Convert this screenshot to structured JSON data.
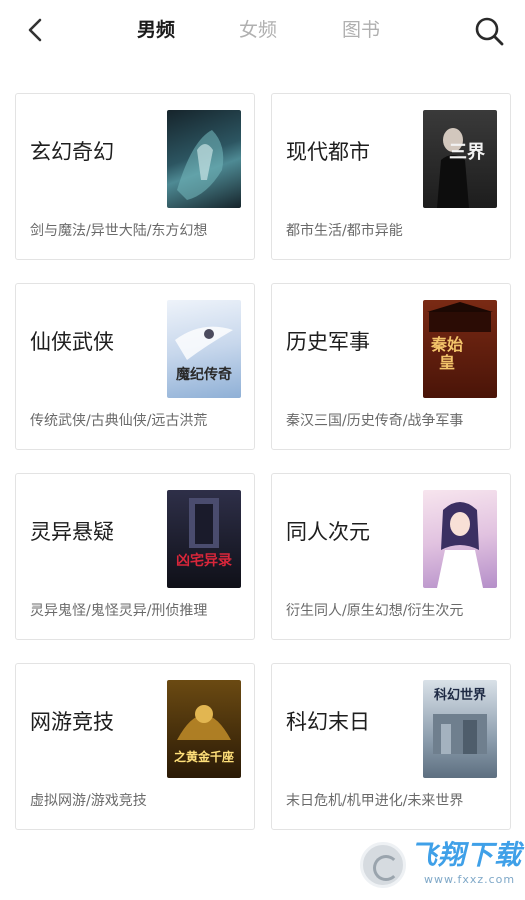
{
  "header": {
    "tabs": [
      {
        "label": "男频",
        "active": true
      },
      {
        "label": "女频",
        "active": false
      },
      {
        "label": "图书",
        "active": false
      }
    ]
  },
  "categories": [
    {
      "title": "玄幻奇幻",
      "subtitle": "剑与魔法/异世大陆/东方幻想",
      "cover_colors": [
        "#16242b",
        "#3f6f7a"
      ],
      "cover_text": ""
    },
    {
      "title": "现代都市",
      "subtitle": "都市生活/都市异能",
      "cover_colors": [
        "#2b2b2b",
        "#6d6d6d"
      ],
      "cover_text": "三界"
    },
    {
      "title": "仙侠武侠",
      "subtitle": "传统武侠/古典仙侠/远古洪荒",
      "cover_colors": [
        "#dfe8f4",
        "#9eb7d6"
      ],
      "cover_text": "魔纪传奇"
    },
    {
      "title": "历史军事",
      "subtitle": "秦汉三国/历史传奇/战争军事",
      "cover_colors": [
        "#5a1c10",
        "#b5482a"
      ],
      "cover_text": "秦始皇"
    },
    {
      "title": "灵异悬疑",
      "subtitle": "灵异鬼怪/鬼怪灵异/刑侦推理",
      "cover_colors": [
        "#141521",
        "#3a3b55"
      ],
      "cover_text": "凶宅异录"
    },
    {
      "title": "同人次元",
      "subtitle": "衍生同人/原生幻想/衍生次元",
      "cover_colors": [
        "#f3dbe8",
        "#c9a1d2"
      ],
      "cover_text": ""
    },
    {
      "title": "网游竞技",
      "subtitle": "虚拟网游/游戏竞技",
      "cover_colors": [
        "#2a1a06",
        "#a06d17"
      ],
      "cover_text": "之黄金千座"
    },
    {
      "title": "科幻末日",
      "subtitle": "末日危机/机甲进化/未来世界",
      "cover_colors": [
        "#9fb0bf",
        "#5d6f80"
      ],
      "cover_text": "科幻世界"
    }
  ],
  "watermark": {
    "title": "飞翔下载",
    "url": "www.fxxz.com"
  },
  "icons": {
    "back": "back-arrow-icon",
    "search": "search-icon"
  }
}
